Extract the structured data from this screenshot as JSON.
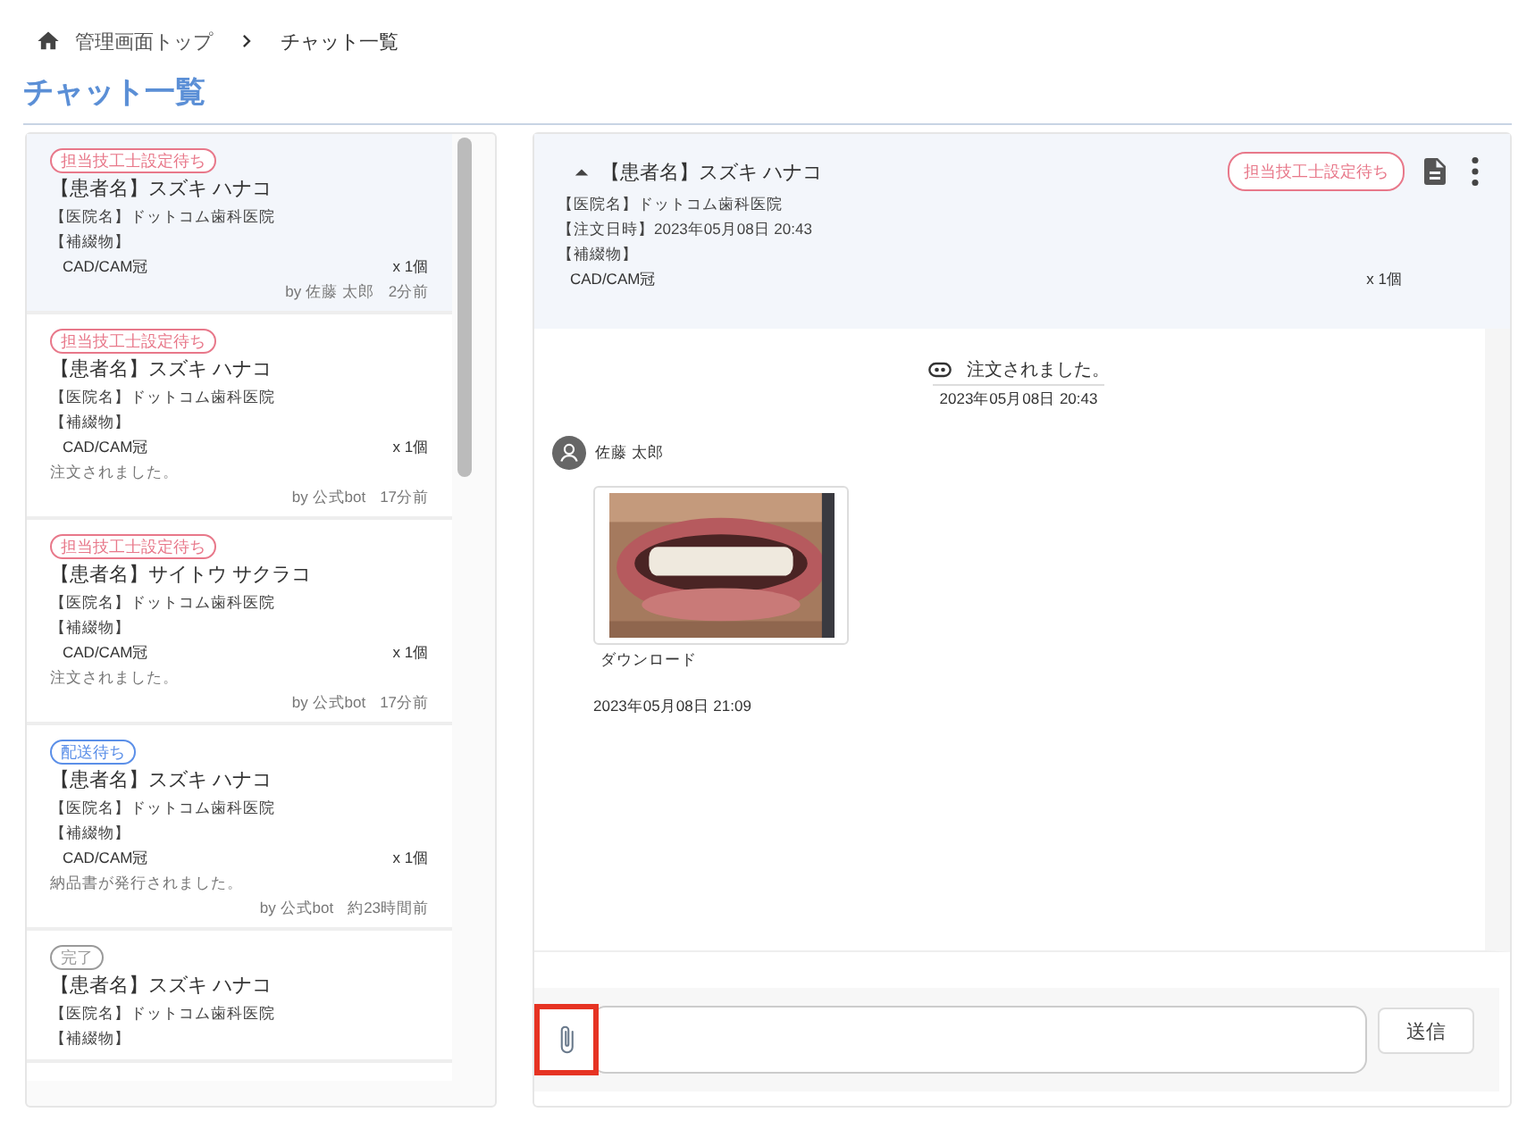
{
  "breadcrumb": [
    {
      "label": "管理画面トップ",
      "kind": "home"
    },
    {
      "label": "チャット一覧",
      "kind": "current"
    }
  ],
  "page_title": "チャット一覧",
  "chat_list": [
    {
      "selected": true,
      "status": {
        "label": "担当技工士設定待ち",
        "color": "#e8788a"
      },
      "patient": "【患者名】スズキ ハナコ",
      "clinic": "【医院名】ドットコム歯科医院",
      "prosthesis_label": "【補綴物】",
      "item": "CAD/CAM冠",
      "quantity": "x 1個",
      "author": "by 佐藤 太郎",
      "time": "2分前"
    },
    {
      "selected": false,
      "status": {
        "label": "担当技工士設定待ち",
        "color": "#e8788a"
      },
      "patient": "【患者名】スズキ ハナコ",
      "clinic": "【医院名】ドットコム歯科医院",
      "prosthesis_label": "【補綴物】",
      "item": "CAD/CAM冠",
      "quantity": "x 1個",
      "last_message": "注文されました。",
      "author": "by 公式bot",
      "time": "17分前"
    },
    {
      "selected": false,
      "status": {
        "label": "担当技工士設定待ち",
        "color": "#e8788a"
      },
      "patient": "【患者名】サイトウ サクラコ",
      "clinic": "【医院名】ドットコム歯科医院",
      "prosthesis_label": "【補綴物】",
      "item": "CAD/CAM冠",
      "quantity": "x 1個",
      "last_message": "注文されました。",
      "author": "by 公式bot",
      "time": "17分前"
    },
    {
      "selected": false,
      "status": {
        "label": "配送待ち",
        "color": "#5b8fe8"
      },
      "patient": "【患者名】スズキ ハナコ",
      "clinic": "【医院名】ドットコム歯科医院",
      "prosthesis_label": "【補綴物】",
      "item": "CAD/CAM冠",
      "quantity": "x 1個",
      "last_message": "納品書が発行されました。",
      "author": "by 公式bot",
      "time": "約23時間前"
    },
    {
      "selected": false,
      "status": {
        "label": "完了",
        "color": "#9a9a9a"
      },
      "patient": "【患者名】スズキ ハナコ",
      "clinic": "【医院名】ドットコム歯科医院",
      "prosthesis_label": "【補綴物】"
    }
  ],
  "chat_header": {
    "expanded": true,
    "patient": "【患者名】スズキ ハナコ",
    "clinic": "【医院名】ドットコム歯科医院",
    "order_date": "【注文日時】2023年05月08日 20:43",
    "prosthesis_label": "【補綴物】",
    "item": "CAD/CAM冠",
    "quantity": "x 1個",
    "status": {
      "label": "担当技工士設定待ち",
      "color": "#e8788a"
    }
  },
  "messages": [
    {
      "kind": "system",
      "text": "注文されました。",
      "time": "2023年05月08日 20:43"
    },
    {
      "kind": "user",
      "author": "佐藤 太郎",
      "attachment": {
        "kind": "picture",
        "link": "ダウンロード"
      },
      "time": "2023年05月08日 21:09"
    }
  ],
  "composer": {
    "attach_highlighted": true,
    "send": "送信"
  }
}
